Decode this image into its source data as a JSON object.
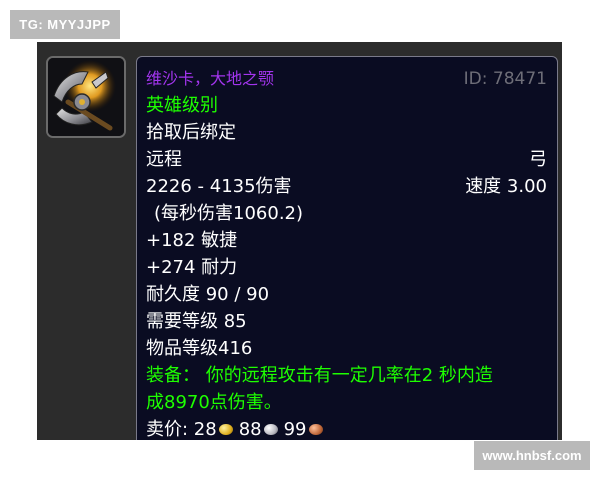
{
  "watermarks": {
    "top_left": "TG: MYYJJPP",
    "bottom_right": "www.hnbsf.com"
  },
  "item": {
    "icon": "axe-bow-weapon-icon",
    "name": "维沙卡，大地之颚",
    "id_label": "ID: 78471",
    "quality": "英雄级别",
    "binding": "拾取后绑定",
    "slot": "远程",
    "type": "弓",
    "damage": "2226 - 4135伤害",
    "speed": "速度 3.00",
    "dps": "(每秒伤害1060.2)",
    "stat1": "+182 敏捷",
    "stat2": "+274 耐力",
    "durability": "耐久度 90 / 90",
    "required_level": "需要等级 85",
    "item_level": "物品等级416",
    "equip_line1": "装备：  你的远程攻击有一定几率在2 秒内造",
    "equip_line2": "成8970点伤害。",
    "sell_label": "卖价: 28",
    "sell_silver": "88",
    "sell_copper": "99"
  },
  "colors": {
    "epic": "#a335ee",
    "uncommon_green": "#1eff00",
    "tooltip_bg": "#0a0c22",
    "id_gray": "#6e6e78"
  }
}
